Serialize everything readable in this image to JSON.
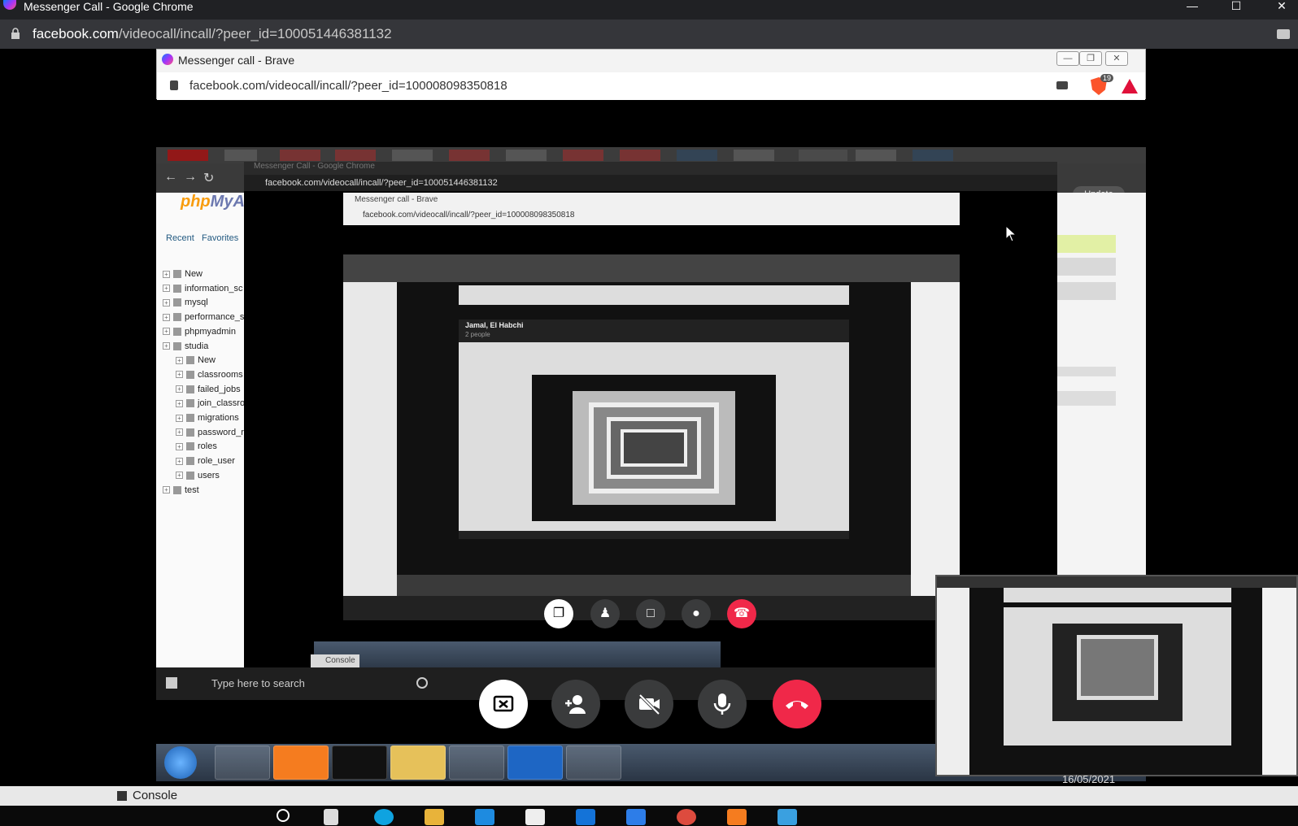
{
  "outer_window": {
    "title": "Messenger Call - Google Chrome",
    "url_host": "facebook.com",
    "url_path": "/videocall/incall/?peer_id=100051446381132"
  },
  "brave_window": {
    "title": "Messenger call - Brave",
    "url": "facebook.com/videocall/incall/?peer_id=100008098350818",
    "shield_count": "19"
  },
  "shared_screen": {
    "update_label": "Update",
    "inner_url": "facebook.com/videocall/incall/?peer_id=100051446381132",
    "inner_title": "Messenger Call - Google Chrome",
    "inner_brave_title": "Messenger call - Brave",
    "inner_brave_url": "facebook.com/videocall/incall/?peer_id=100008098350818",
    "call_name": "Jamal, El Habchi",
    "call_people": "2 people",
    "console_label": "Console",
    "search_placeholder": "Type here to search"
  },
  "phpmyadmin": {
    "logo_php": "php",
    "logo_my": "MyA",
    "links": [
      "Recent",
      "Favorites"
    ],
    "tree": [
      {
        "label": "New",
        "level": 0
      },
      {
        "label": "information_sc",
        "level": 0
      },
      {
        "label": "mysql",
        "level": 0
      },
      {
        "label": "performance_s",
        "level": 0
      },
      {
        "label": "phpmyadmin",
        "level": 0
      },
      {
        "label": "studia",
        "level": 0
      },
      {
        "label": "New",
        "level": 1
      },
      {
        "label": "classrooms",
        "level": 1
      },
      {
        "label": "failed_jobs",
        "level": 1
      },
      {
        "label": "join_classro",
        "level": 1
      },
      {
        "label": "migrations",
        "level": 1
      },
      {
        "label": "password_r",
        "level": 1
      },
      {
        "label": "roles",
        "level": 1
      },
      {
        "label": "role_user",
        "level": 1
      },
      {
        "label": "users",
        "level": 1
      },
      {
        "label": "test",
        "level": 0
      }
    ]
  },
  "taskbar_date": "16/05/2021",
  "console": {
    "label": "Console"
  },
  "colors": {
    "end_call": "#f02849",
    "control_gray": "#3a3b3c",
    "brave_orange": "#fb542b",
    "php_blue": "#6c78af"
  },
  "icons": [
    "share-screen-icon",
    "add-person-icon",
    "camera-off-icon",
    "microphone-icon",
    "end-call-icon"
  ]
}
